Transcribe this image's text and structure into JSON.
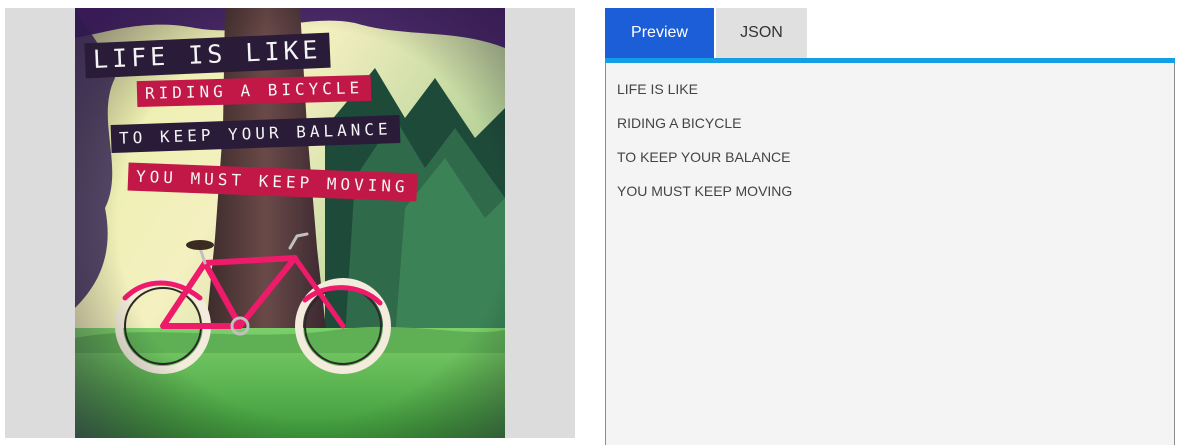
{
  "image": {
    "poster_lines": [
      "LIFE IS LIKE",
      "RIDING A BICYCLE",
      "TO KEEP YOUR BALANCE",
      "YOU MUST KEEP MOVING"
    ]
  },
  "tabs": [
    {
      "label": "Preview",
      "active": true
    },
    {
      "label": "JSON",
      "active": false
    }
  ],
  "preview": {
    "lines": [
      "LIFE IS LIKE",
      "RIDING A BICYCLE",
      "TO KEEP YOUR BALANCE",
      "YOU MUST KEEP MOVING"
    ]
  },
  "colors": {
    "tab_active": "#1c5dd8",
    "accent": "#139ee6",
    "panel_bg": "#f4f4f4",
    "banner_dark": "#2a1b38",
    "banner_red": "#c21848"
  }
}
